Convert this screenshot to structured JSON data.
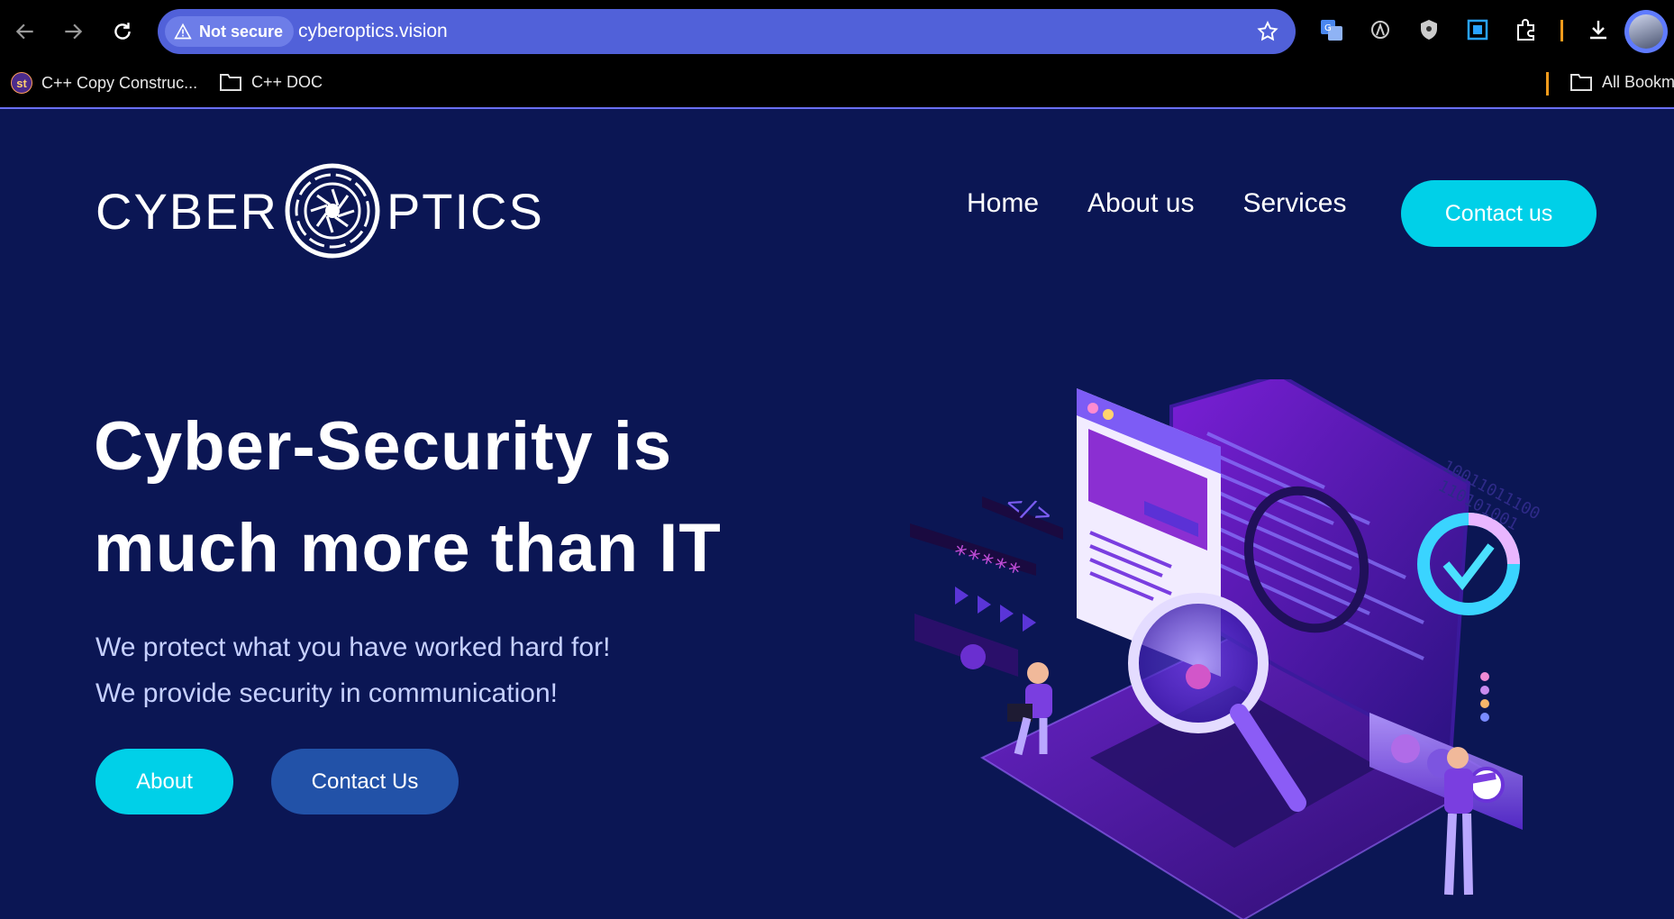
{
  "browser": {
    "security_label": "Not secure",
    "url": "cyberoptics.vision",
    "bookmarks": [
      {
        "label": "C++ Copy Construc...",
        "favicon_text": "st"
      },
      {
        "label": "C++ DOC"
      },
      {
        "label": "All Bookm"
      }
    ]
  },
  "site": {
    "logo_left": "CYBER",
    "logo_right": "PTICS",
    "nav": [
      "Home",
      "About us",
      "Services"
    ],
    "nav_cta": "Contact us"
  },
  "hero": {
    "title_line1": "Cyber-Security is",
    "title_line2": "much more than IT",
    "sub_line1": "We protect what you have worked hard for!",
    "sub_line2": "We provide security in communication!",
    "btn_about": "About",
    "btn_contact": "Contact Us"
  },
  "colors": {
    "page_bg": "#0b1654",
    "accent_cyan": "#00d0e8",
    "button_blue": "#2252a8",
    "omnibox": "#5161d9"
  }
}
